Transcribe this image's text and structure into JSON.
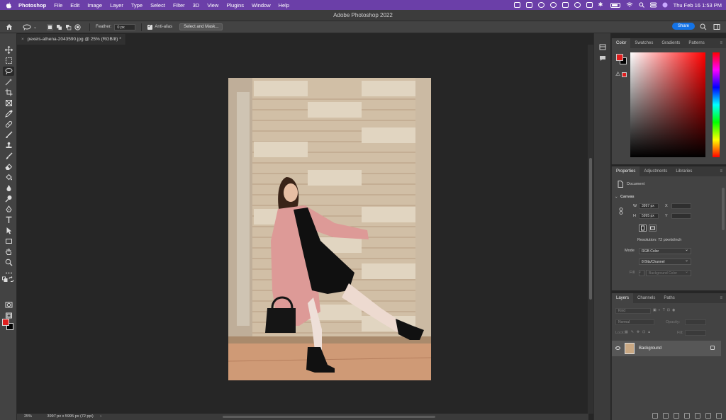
{
  "menubar": {
    "app": "Photoshop",
    "items": [
      "File",
      "Edit",
      "Image",
      "Layer",
      "Type",
      "Select",
      "Filter",
      "3D",
      "View",
      "Plugins",
      "Window",
      "Help"
    ],
    "clock": "Thu Feb 16  1:53 PM",
    "bg_color": "#6b3fa8"
  },
  "window": {
    "title": "Adobe Photoshop 2022"
  },
  "options": {
    "feather_label": "Feather:",
    "feather_value": "0 px",
    "antialias_label": "Anti-alias",
    "select_mask_label": "Select and Mask...",
    "share_label": "Share"
  },
  "document": {
    "tab_label": "pexels-athena-2043590.jpg @ 25% (RGB/8) *"
  },
  "status": {
    "zoom": "25%",
    "info": "3997 px x 5995 px (72 ppi)"
  },
  "color_panel": {
    "tabs": [
      "Color",
      "Swatches",
      "Gradients",
      "Patterns"
    ],
    "fg_color": "#e01e1e",
    "bg_color": "#000000"
  },
  "properties": {
    "tabs": [
      "Properties",
      "Adjustments",
      "Libraries"
    ],
    "doc_label": "Document",
    "canvas_label": "Canvas",
    "w_label": "W",
    "w_value": "3997 px",
    "h_label": "H",
    "h_value": "5995 px",
    "x_label": "X",
    "y_label": "Y",
    "resolution": "Resolution: 72 pixels/inch",
    "mode_label": "Mode",
    "mode_value": "RGB Color",
    "bits_value": "8 Bits/Channel",
    "fill_label": "Fill",
    "fill_value": "Background Color"
  },
  "layers": {
    "tabs": [
      "Layers",
      "Channels",
      "Paths"
    ],
    "kind_placeholder": "Kind",
    "blend_mode": "Normal",
    "opacity_label": "Opacity:",
    "lock_label": "Lock:",
    "fill_label": "Fill:",
    "layer_name": "Background"
  },
  "tools": [
    "move-tool",
    "marquee-tool",
    "lasso-tool",
    "magic-wand-tool",
    "crop-tool",
    "frame-tool",
    "eyedropper-tool",
    "healing-brush-tool",
    "brush-tool",
    "clone-stamp-tool",
    "history-brush-tool",
    "eraser-tool",
    "gradient-tool",
    "blur-tool",
    "dodge-tool",
    "pen-tool",
    "type-tool",
    "path-selection-tool",
    "rectangle-tool",
    "hand-tool",
    "zoom-tool",
    "more-tools"
  ]
}
